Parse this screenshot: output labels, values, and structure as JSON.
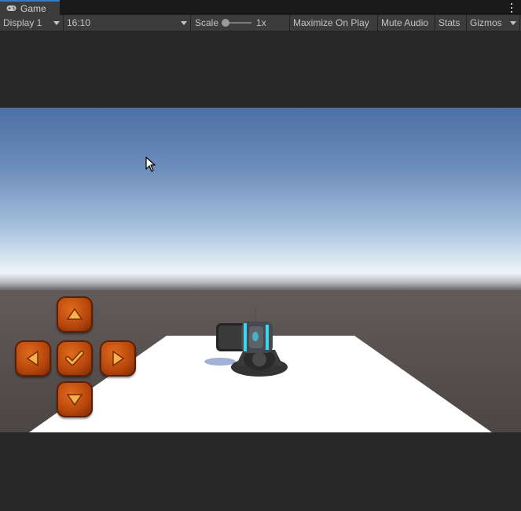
{
  "tab": {
    "icon": "gamepad-icon",
    "label": "Game"
  },
  "toolbar": {
    "display": "Display 1",
    "aspect": "16:10",
    "scale_label": "Scale",
    "scale_value": "1x",
    "maximize_on_play": "Maximize On Play",
    "mute_audio": "Mute Audio",
    "stats": "Stats",
    "gizmos": "Gizmos"
  },
  "scene": {
    "controls": [
      "up-arrow-icon",
      "left-arrow-icon",
      "check-icon",
      "right-arrow-icon",
      "down-arrow-icon"
    ],
    "button_color": "#c4520f",
    "plane_color": "#ffffff",
    "turret_glow_color": "#3fd3f0"
  }
}
